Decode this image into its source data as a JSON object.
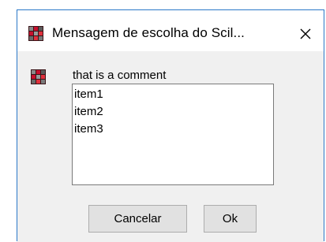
{
  "window": {
    "title": "Mensagem de escolha do Scil...",
    "app_icon": "scilab-icon",
    "close_icon": "close-icon"
  },
  "message": "that is a comment",
  "list": {
    "items": [
      "item1",
      "item2",
      "item3"
    ]
  },
  "buttons": {
    "cancel_label": "Cancelar",
    "ok_label": "Ok"
  },
  "colors": {
    "window_border": "#2b78c8",
    "content_background": "#f0f0f0",
    "button_background": "#e1e1e1"
  }
}
